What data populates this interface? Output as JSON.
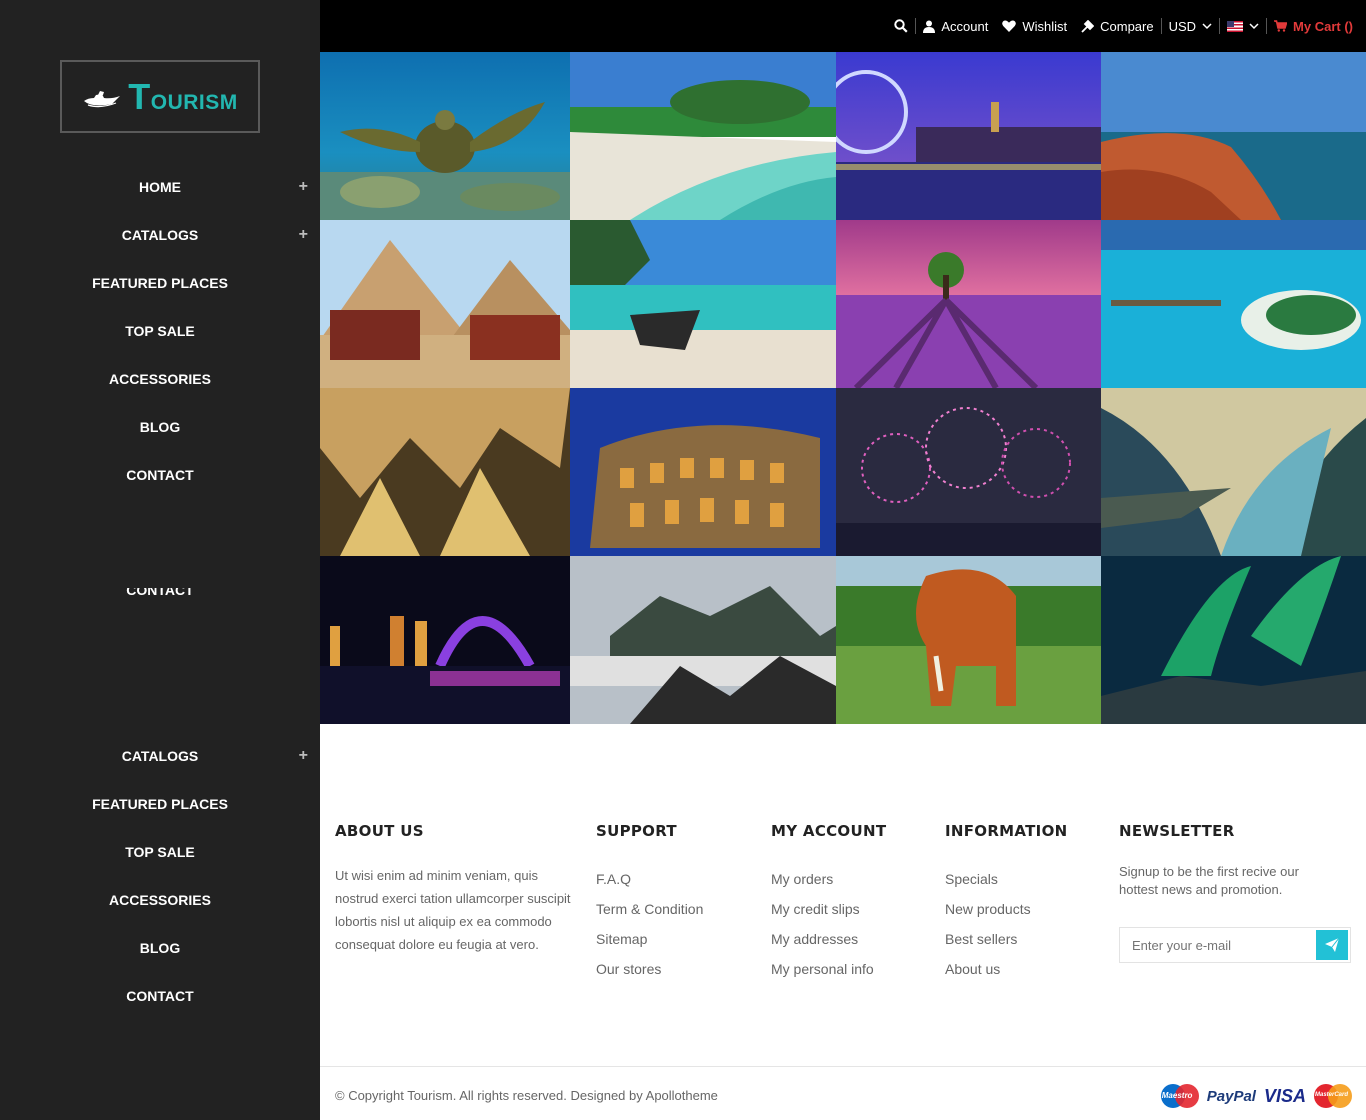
{
  "brand": {
    "logo_initial": "T",
    "logo_rest": "OURISM",
    "color": "#22b7b0"
  },
  "sidebar": {
    "primary_nav": [
      {
        "label": "HOME",
        "expandable": true
      },
      {
        "label": "CATALOGS",
        "expandable": true
      },
      {
        "label": "FEATURED PLACES",
        "expandable": false
      },
      {
        "label": "TOP SALE",
        "expandable": false
      },
      {
        "label": "ACCESSORIES",
        "expandable": false
      },
      {
        "label": "BLOG",
        "expandable": false
      },
      {
        "label": "CONTACT",
        "expandable": false
      }
    ],
    "ghost_label": "CONTACT",
    "secondary_nav": [
      {
        "label": "CATALOGS",
        "expandable": true
      },
      {
        "label": "FEATURED PLACES",
        "expandable": false
      },
      {
        "label": "TOP SALE",
        "expandable": false
      },
      {
        "label": "ACCESSORIES",
        "expandable": false
      },
      {
        "label": "BLOG",
        "expandable": false
      },
      {
        "label": "CONTACT",
        "expandable": false
      }
    ],
    "plus_symbol": "+"
  },
  "topbar": {
    "account_label": "Account",
    "wishlist_label": "Wishlist",
    "compare_label": "Compare",
    "currency": "USD",
    "cart_label": "My Cart ()",
    "cart_color": "#e23a3a"
  },
  "gallery": [
    "sea-turtle",
    "tropical-beach",
    "london-eye-night",
    "coastal-cliffs",
    "pyramids-camels",
    "longtail-boat",
    "lavender-field",
    "maldives-island",
    "cave-stalactites",
    "colosseum-night",
    "fireworks-city",
    "fjord-cliff",
    "city-night-fountain",
    "misty-mountains",
    "elephant",
    "aurora"
  ],
  "footer": {
    "about": {
      "title": "ABOUT US",
      "text": "Ut wisi enim ad minim veniam, quis nostrud exerci tation ullamcorper suscipit lobortis nisl ut aliquip ex ea commodo consequat dolore eu feugia at vero."
    },
    "support": {
      "title": "SUPPORT",
      "links": [
        "F.A.Q",
        "Term & Condition",
        "Sitemap",
        "Our stores"
      ]
    },
    "account": {
      "title": "MY ACCOUNT",
      "links": [
        "My orders",
        "My credit slips",
        "My addresses",
        "My personal info"
      ]
    },
    "information": {
      "title": "INFORMATION",
      "links": [
        "Specials",
        "New products",
        "Best sellers",
        "About us"
      ]
    },
    "newsletter": {
      "title": "NEWSLETTER",
      "text": "Signup to be the first recive our hottest news and promotion.",
      "placeholder": "Enter your e-mail",
      "button_color": "#22c1d6"
    },
    "copyright": "© Copyright Tourism. All rights reserved. Designed by Apollotheme",
    "payments": {
      "maestro": "Maestro",
      "paypal": "PayPal",
      "visa": "VISA",
      "mastercard": "MasterCard"
    }
  }
}
